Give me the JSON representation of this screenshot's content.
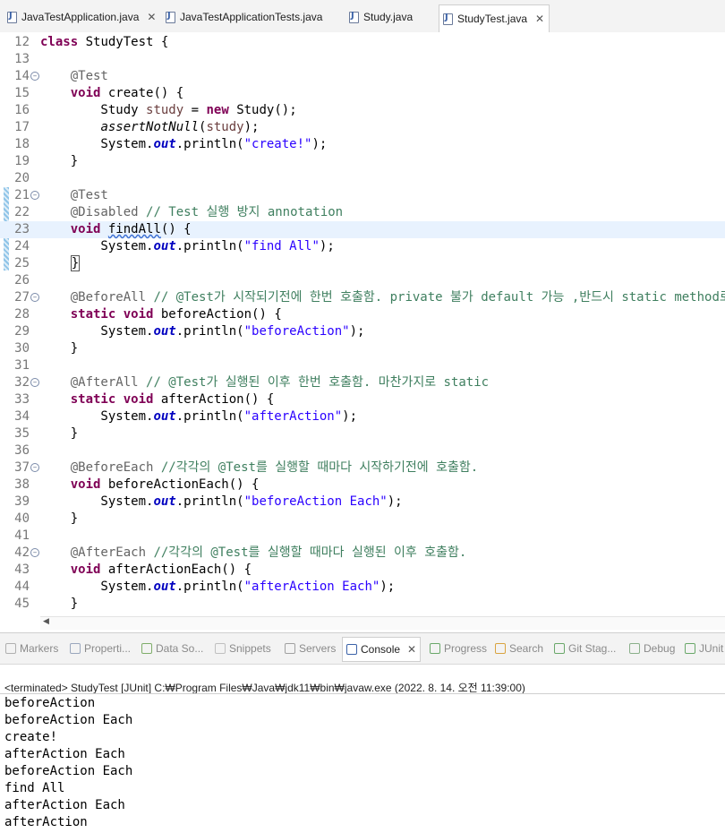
{
  "editor_tabs": [
    {
      "label": "JavaTestApplication.java",
      "close": "✕"
    },
    {
      "label": "JavaTestApplicationTests.java"
    },
    {
      "label": "Study.java"
    },
    {
      "label": "StudyTest.java",
      "close": "✕",
      "active": true
    }
  ],
  "code_lines": [
    {
      "n": "12",
      "html": "<span class='kw'>class</span> StudyTest {"
    },
    {
      "n": "13",
      "html": ""
    },
    {
      "n": "14",
      "fold": true,
      "html": "    <span class='ann'>@Test</span>"
    },
    {
      "n": "15",
      "html": "    <span class='kw'>void</span> create() {"
    },
    {
      "n": "16",
      "html": "        Study <span class='vr'>study</span> = <span class='kw'>new</span> Study();"
    },
    {
      "n": "17",
      "html": "        <span class='it'>assertNotNull</span>(<span class='vr'>study</span>);"
    },
    {
      "n": "18",
      "html": "        System.<span class='fl'>out</span>.println(<span class='st'>\"create!\"</span>);"
    },
    {
      "n": "19",
      "html": "    }"
    },
    {
      "n": "20",
      "html": ""
    },
    {
      "n": "21",
      "fold": true,
      "html": "    <span class='ann'>@Test</span>"
    },
    {
      "n": "22",
      "html": "    <span class='ann'>@Disabled</span> <span class='cm'>// Test 실행 방지 annotation</span>"
    },
    {
      "n": "23",
      "cur": true,
      "html": "    <span class='kw'>void</span> <span class='sq'>findAll</span>() {"
    },
    {
      "n": "24",
      "html": "        System.<span class='fl'>out</span>.println(<span class='st'>\"find All\"</span>);"
    },
    {
      "n": "25",
      "html": "    <span class='caret'>}</span>"
    },
    {
      "n": "26",
      "html": ""
    },
    {
      "n": "27",
      "fold": true,
      "html": "    <span class='ann'>@BeforeAll</span> <span class='cm'>// @Test가 시작되기전에 한번 호출함. private 불가 default 가능 ,반드시 static method로 선언</span>"
    },
    {
      "n": "28",
      "html": "    <span class='kw'>static</span> <span class='kw'>void</span> beforeAction() {"
    },
    {
      "n": "29",
      "html": "        System.<span class='fl'>out</span>.println(<span class='st'>\"beforeAction\"</span>);"
    },
    {
      "n": "30",
      "html": "    }"
    },
    {
      "n": "31",
      "html": ""
    },
    {
      "n": "32",
      "fold": true,
      "html": "    <span class='ann'>@AfterAll</span> <span class='cm'>// @Test가 실행된 이후 한번 호출함. 마찬가지로 static</span>"
    },
    {
      "n": "33",
      "html": "    <span class='kw'>static</span> <span class='kw'>void</span> afterAction() {"
    },
    {
      "n": "34",
      "html": "        System.<span class='fl'>out</span>.println(<span class='st'>\"afterAction\"</span>);"
    },
    {
      "n": "35",
      "html": "    }"
    },
    {
      "n": "36",
      "html": ""
    },
    {
      "n": "37",
      "fold": true,
      "html": "    <span class='ann'>@BeforeEach</span> <span class='cm'>//각각의 @Test를 실행할 때마다 시작하기전에 호출함.</span>"
    },
    {
      "n": "38",
      "html": "    <span class='kw'>void</span> beforeActionEach() {"
    },
    {
      "n": "39",
      "html": "        System.<span class='fl'>out</span>.println(<span class='st'>\"beforeAction Each\"</span>);"
    },
    {
      "n": "40",
      "html": "    }"
    },
    {
      "n": "41",
      "html": ""
    },
    {
      "n": "42",
      "fold": true,
      "html": "    <span class='ann'>@AfterEach</span> <span class='cm'>//각각의 @Test를 실행할 때마다 실행된 이후 호출함.</span>"
    },
    {
      "n": "43",
      "html": "    <span class='kw'>void</span> afterActionEach() {"
    },
    {
      "n": "44",
      "html": "        System.<span class='fl'>out</span>.println(<span class='st'>\"afterAction Each\"</span>);"
    },
    {
      "n": "45",
      "html": "    }"
    }
  ],
  "view_tabs": [
    {
      "label": "Markers",
      "icon": "markers-icon"
    },
    {
      "label": "Properti...",
      "icon": "properties-icon"
    },
    {
      "label": "Data So...",
      "icon": "data-source-icon"
    },
    {
      "label": "Snippets",
      "icon": "snippets-icon"
    },
    {
      "label": "Servers",
      "icon": "servers-icon"
    },
    {
      "label": "Console",
      "icon": "console-icon",
      "active": true,
      "close": "✕"
    },
    {
      "label": "Progress",
      "icon": "progress-icon"
    },
    {
      "label": "Search",
      "icon": "search-icon"
    },
    {
      "label": "Git Stag...",
      "icon": "git-staging-icon"
    },
    {
      "label": "Debug",
      "icon": "debug-icon"
    },
    {
      "label": "JUnit",
      "icon": "junit-icon"
    }
  ],
  "console": {
    "header": "<terminated> StudyTest [JUnit] C:₩Program Files₩Java₩jdk11₩bin₩javaw.exe  (2022. 8. 14. 오전 11:39:00)",
    "lines": [
      "beforeAction",
      "beforeAction Each",
      "create!",
      "afterAction Each",
      "beforeAction Each",
      "find All",
      "afterAction Each",
      "afterAction"
    ]
  },
  "colors": {
    "keyword": "#7f0055",
    "annotation": "#646464",
    "comment": "#3f7f5f",
    "string": "#2a00ff",
    "field": "#0000c0",
    "current_line": "#e8f2fe"
  }
}
